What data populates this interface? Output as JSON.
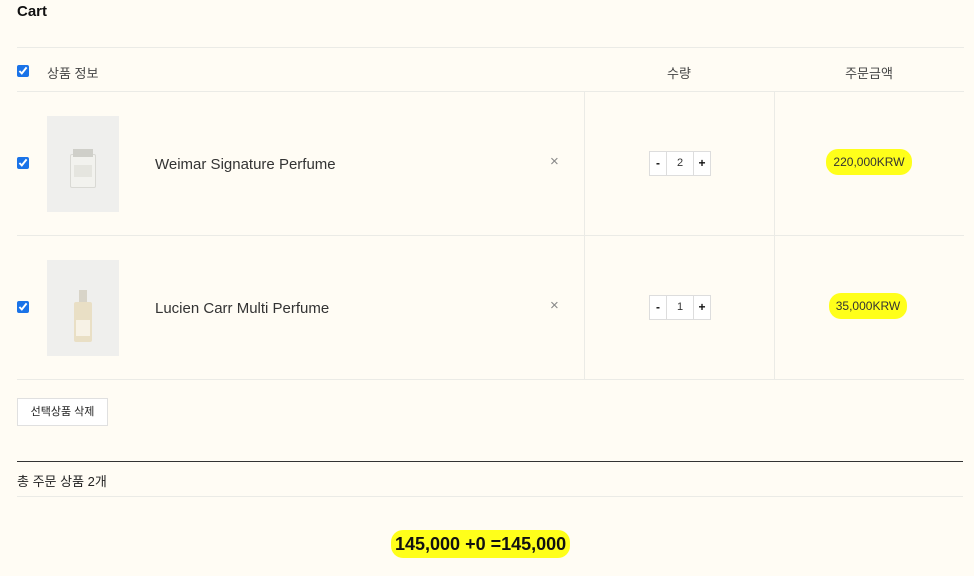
{
  "page": {
    "title": "Cart"
  },
  "table_header": {
    "product_info": "상품 정보",
    "quantity": "수량",
    "order_amount": "주문금액"
  },
  "items": [
    {
      "name": "Weimar Signature Perfume",
      "quantity": "2",
      "price": "220,000KRW",
      "checked": true
    },
    {
      "name": "Lucien Carr Multi Perfume",
      "quantity": "1",
      "price": "35,000KRW",
      "checked": true
    }
  ],
  "stepper": {
    "minus": "-",
    "plus": "+"
  },
  "remove_icon": "×",
  "actions": {
    "delete_selected": "선택상품 삭제"
  },
  "summary": {
    "total_count": "총 주문 상품 2개",
    "grand_total": "145,000 +0 =145,000"
  },
  "colors": {
    "background": "#fffcf4",
    "highlight": "#ffff1a",
    "checkbox": "#1a73e8"
  }
}
